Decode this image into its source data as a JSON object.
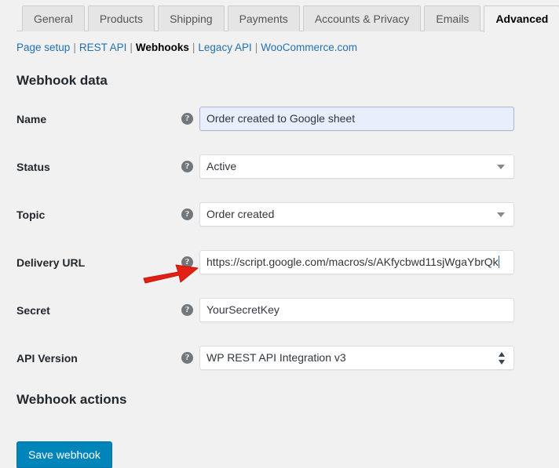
{
  "tabs": [
    {
      "label": "General",
      "active": false
    },
    {
      "label": "Products",
      "active": false
    },
    {
      "label": "Shipping",
      "active": false
    },
    {
      "label": "Payments",
      "active": false
    },
    {
      "label": "Accounts & Privacy",
      "active": false
    },
    {
      "label": "Emails",
      "active": false
    },
    {
      "label": "Advanced",
      "active": true
    }
  ],
  "subnav": {
    "items": [
      {
        "label": "Page setup",
        "current": false
      },
      {
        "label": "REST API",
        "current": false
      },
      {
        "label": "Webhooks",
        "current": true
      },
      {
        "label": "Legacy API",
        "current": false
      },
      {
        "label": "WooCommerce.com",
        "current": false
      }
    ],
    "separator": "|"
  },
  "sections": {
    "webhook_data_title": "Webhook data",
    "webhook_actions_title": "Webhook actions"
  },
  "help_icon_glyph": "?",
  "fields": {
    "name": {
      "label": "Name",
      "value": "Order created to Google sheet",
      "type": "text"
    },
    "status": {
      "label": "Status",
      "value": "Active",
      "type": "select"
    },
    "topic": {
      "label": "Topic",
      "value": "Order created",
      "type": "select"
    },
    "delivery_url": {
      "label": "Delivery URL",
      "value": "https://script.google.com/macros/s/AKfycbwd11sjWgaYbrQk",
      "type": "text"
    },
    "secret": {
      "label": "Secret",
      "value": "YourSecretKey",
      "type": "text"
    },
    "api_version": {
      "label": "API Version",
      "value": "WP REST API Integration v3",
      "type": "select-stepper"
    }
  },
  "buttons": {
    "save_webhook": "Save webhook"
  },
  "colors": {
    "page_background": "#f1f1f1",
    "link": "#2271b1",
    "primary_button": "#0085ba",
    "annotation_arrow": "#e32013",
    "autofill_background": "#e8eefb",
    "help_icon": "#72777c"
  }
}
